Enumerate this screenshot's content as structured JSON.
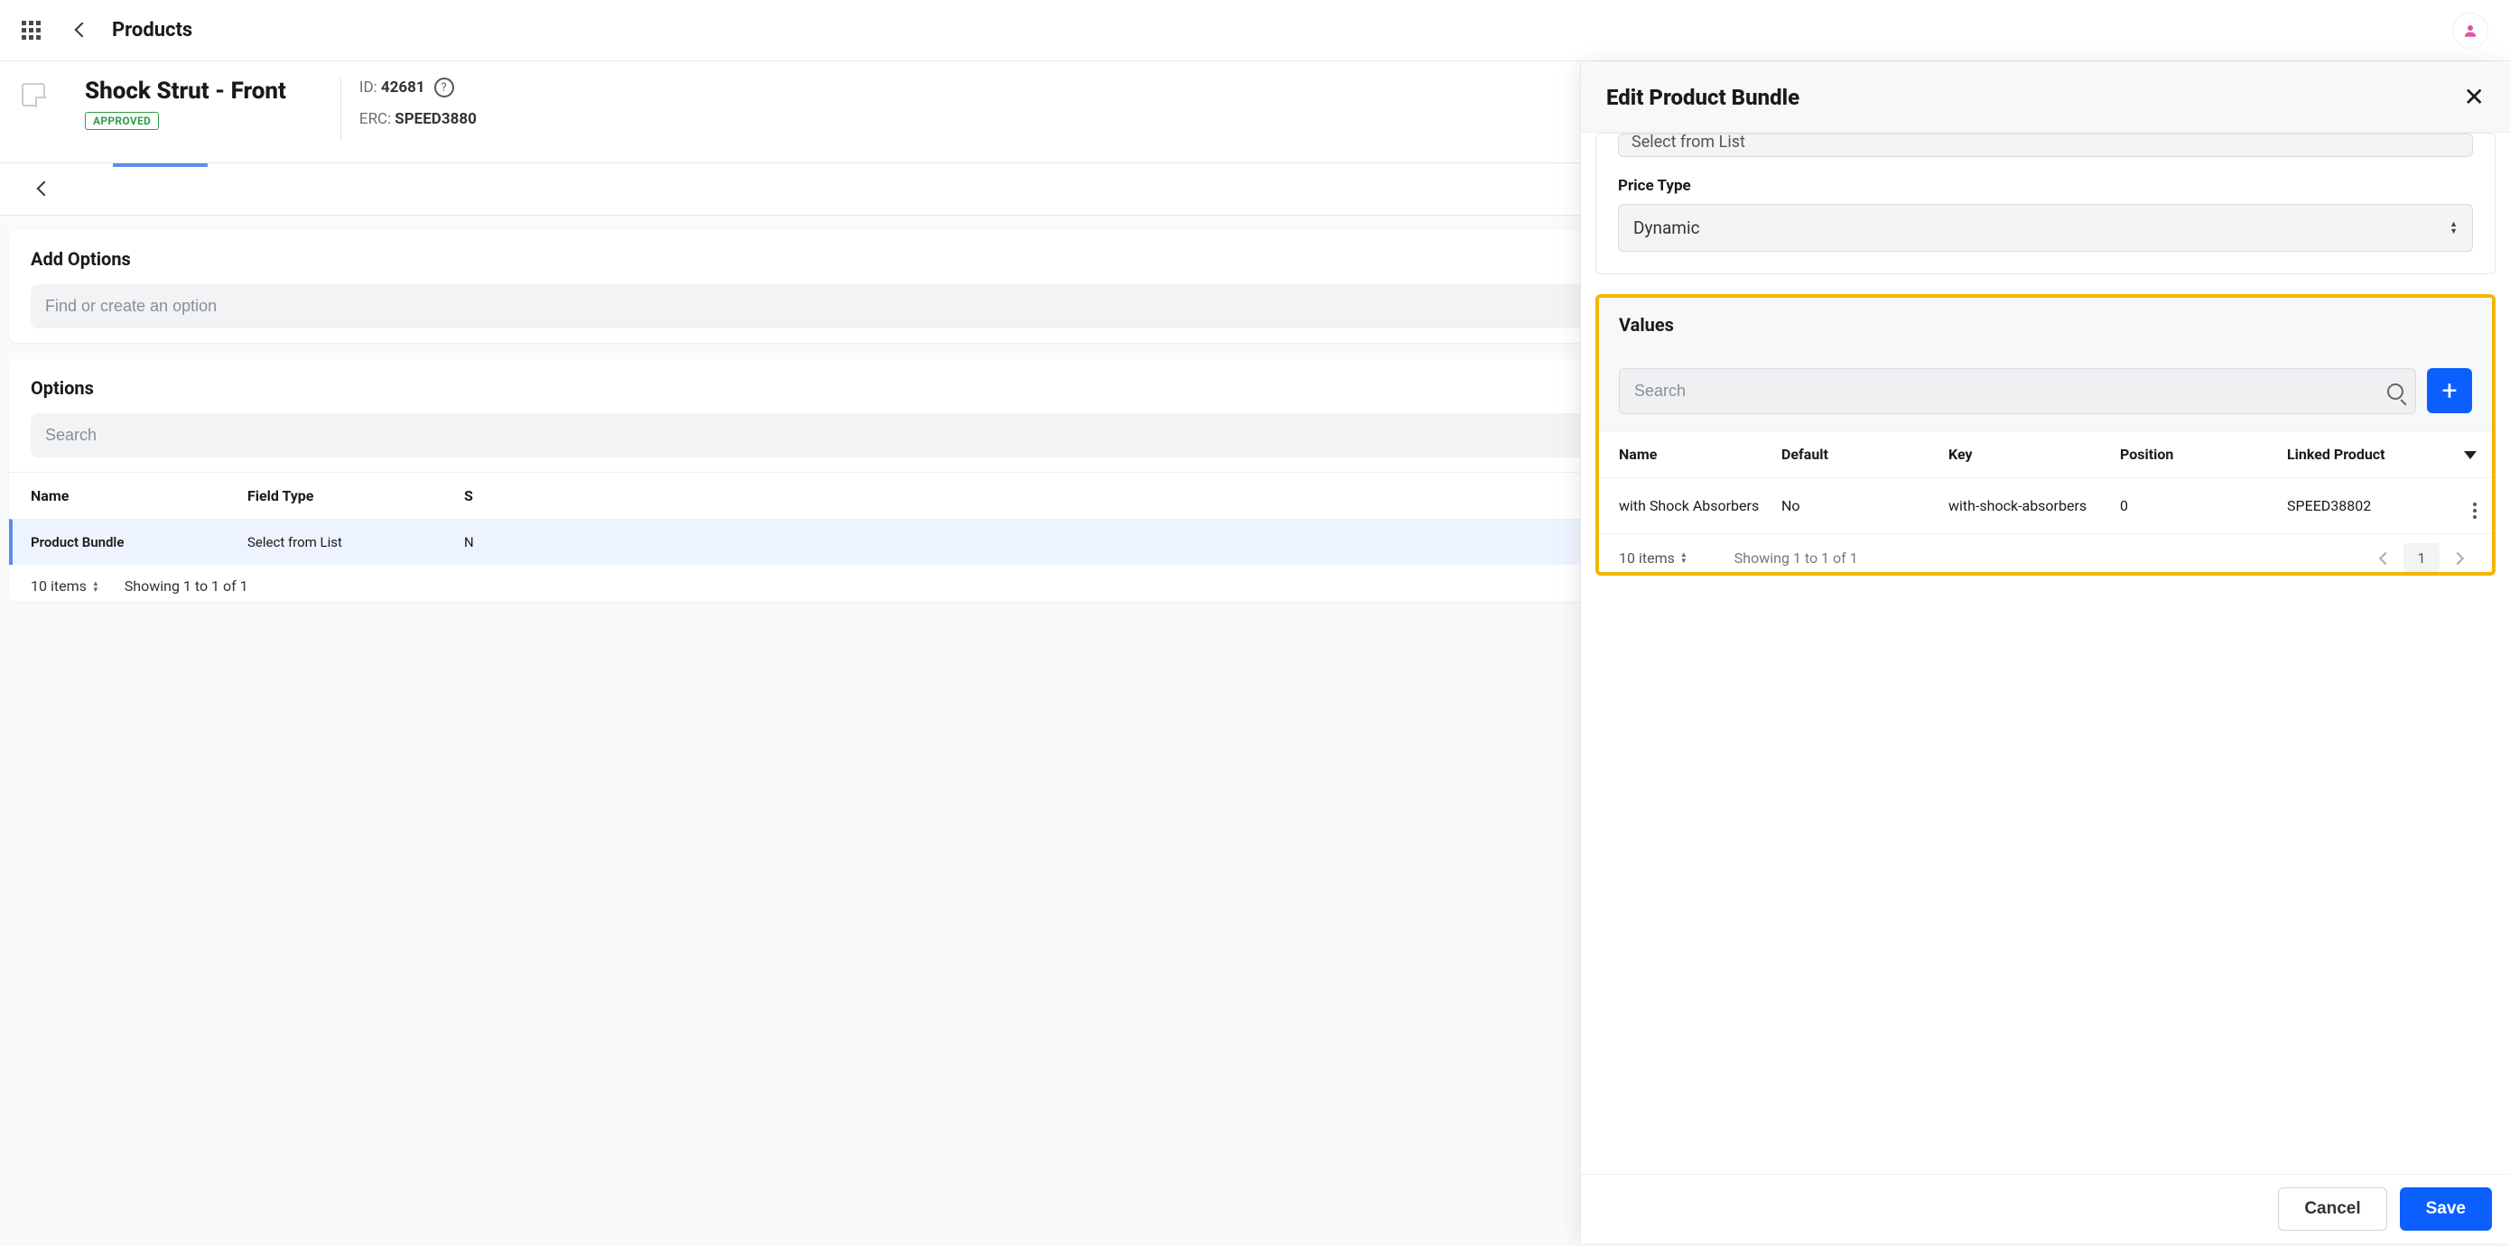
{
  "topbar": {
    "page_title": "Products"
  },
  "product": {
    "title": "Shock Strut - Front",
    "status": "APPROVED",
    "id_label": "ID:",
    "id_value": "42681",
    "erc_label": "ERC:",
    "erc_value": "SPEED3880"
  },
  "add_options": {
    "title": "Add Options",
    "placeholder": "Find or create an option"
  },
  "options_panel": {
    "title": "Options",
    "search_placeholder": "Search",
    "columns": {
      "name": "Name",
      "field_type": "Field Type",
      "s": "S"
    },
    "row": {
      "name": "Product Bundle",
      "field_type": "Select from List",
      "s": "N"
    },
    "footer": {
      "items": "10 items",
      "showing": "Showing 1 to 1 of 1"
    }
  },
  "drawer": {
    "title": "Edit Product Bundle",
    "partial_select": "Select from List",
    "price_type_label": "Price Type",
    "price_type_value": "Dynamic",
    "values": {
      "title": "Values",
      "search_placeholder": "Search",
      "columns": {
        "name": "Name",
        "default": "Default",
        "key": "Key",
        "position": "Position",
        "linked": "Linked Product"
      },
      "row": {
        "name": "with Shock Absorbers",
        "default": "No",
        "key": "with-shock-absorbers",
        "position": "0",
        "linked": "SPEED38802"
      },
      "footer": {
        "items": "10 items",
        "showing": "Showing 1 to 1 of 1",
        "page": "1"
      }
    },
    "cancel": "Cancel",
    "save": "Save"
  }
}
